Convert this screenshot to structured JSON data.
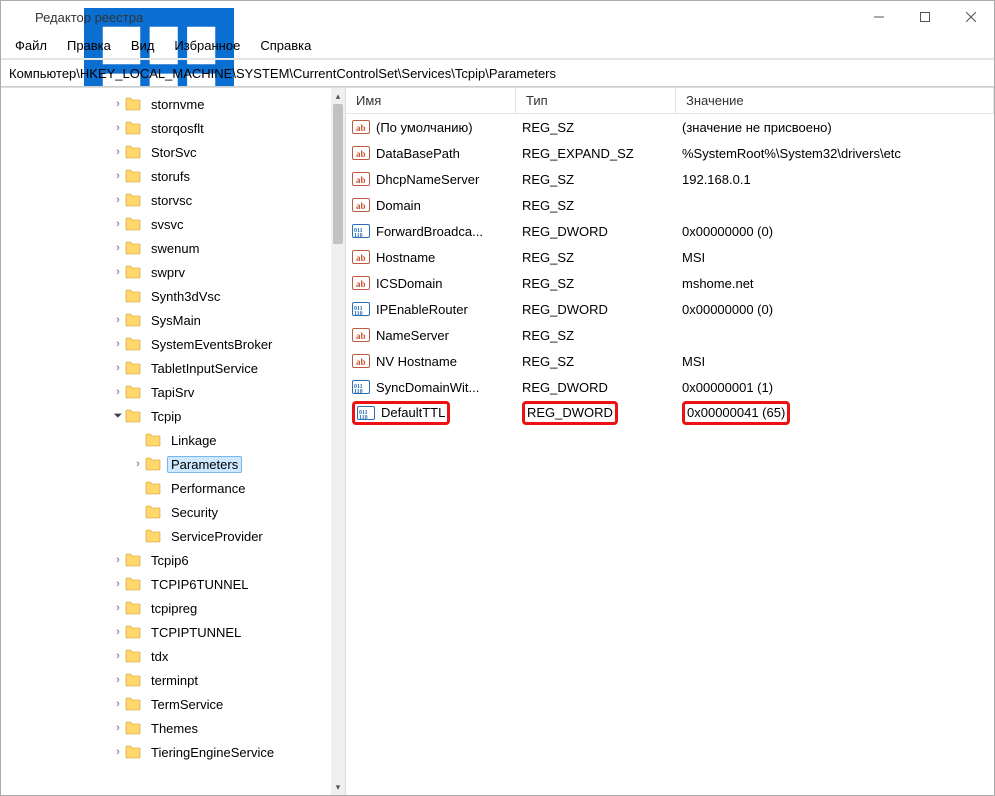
{
  "window": {
    "title": "Редактор реестра"
  },
  "menu": {
    "file": "Файл",
    "edit": "Правка",
    "view": "Вид",
    "fav": "Избранное",
    "help": "Справка"
  },
  "address": "Компьютер\\HKEY_LOCAL_MACHINE\\SYSTEM\\CurrentControlSet\\Services\\Tcpip\\Parameters",
  "tree": {
    "items": [
      {
        "label": "stornvme",
        "depth": 4,
        "chev": "closed"
      },
      {
        "label": "storqosflt",
        "depth": 4,
        "chev": "closed"
      },
      {
        "label": "StorSvc",
        "depth": 4,
        "chev": "closed"
      },
      {
        "label": "storufs",
        "depth": 4,
        "chev": "closed"
      },
      {
        "label": "storvsc",
        "depth": 4,
        "chev": "closed"
      },
      {
        "label": "svsvc",
        "depth": 4,
        "chev": "closed"
      },
      {
        "label": "swenum",
        "depth": 4,
        "chev": "closed"
      },
      {
        "label": "swprv",
        "depth": 4,
        "chev": "closed"
      },
      {
        "label": "Synth3dVsc",
        "depth": 4,
        "chev": "none"
      },
      {
        "label": "SysMain",
        "depth": 4,
        "chev": "closed"
      },
      {
        "label": "SystemEventsBroker",
        "depth": 4,
        "chev": "closed"
      },
      {
        "label": "TabletInputService",
        "depth": 4,
        "chev": "closed"
      },
      {
        "label": "TapiSrv",
        "depth": 4,
        "chev": "closed"
      },
      {
        "label": "Tcpip",
        "depth": 4,
        "chev": "open"
      },
      {
        "label": "Linkage",
        "depth": 5,
        "chev": "none"
      },
      {
        "label": "Parameters",
        "depth": 5,
        "chev": "closed",
        "selected": true
      },
      {
        "label": "Performance",
        "depth": 5,
        "chev": "none"
      },
      {
        "label": "Security",
        "depth": 5,
        "chev": "none"
      },
      {
        "label": "ServiceProvider",
        "depth": 5,
        "chev": "none"
      },
      {
        "label": "Tcpip6",
        "depth": 4,
        "chev": "closed"
      },
      {
        "label": "TCPIP6TUNNEL",
        "depth": 4,
        "chev": "closed"
      },
      {
        "label": "tcpipreg",
        "depth": 4,
        "chev": "closed"
      },
      {
        "label": "TCPIPTUNNEL",
        "depth": 4,
        "chev": "closed"
      },
      {
        "label": "tdx",
        "depth": 4,
        "chev": "closed"
      },
      {
        "label": "terminpt",
        "depth": 4,
        "chev": "closed"
      },
      {
        "label": "TermService",
        "depth": 4,
        "chev": "closed"
      },
      {
        "label": "Themes",
        "depth": 4,
        "chev": "closed"
      },
      {
        "label": "TieringEngineService",
        "depth": 4,
        "chev": "closed"
      }
    ]
  },
  "columns": {
    "name": "Имя",
    "type": "Тип",
    "value": "Значение"
  },
  "values": [
    {
      "icon": "sz",
      "name": "(По умолчанию)",
      "type": "REG_SZ",
      "value": "(значение не присвоено)"
    },
    {
      "icon": "sz",
      "name": "DataBasePath",
      "type": "REG_EXPAND_SZ",
      "value": "%SystemRoot%\\System32\\drivers\\etc"
    },
    {
      "icon": "sz",
      "name": "DhcpNameServer",
      "type": "REG_SZ",
      "value": "192.168.0.1"
    },
    {
      "icon": "sz",
      "name": "Domain",
      "type": "REG_SZ",
      "value": ""
    },
    {
      "icon": "bin",
      "name": "ForwardBroadca...",
      "type": "REG_DWORD",
      "value": "0x00000000 (0)"
    },
    {
      "icon": "sz",
      "name": "Hostname",
      "type": "REG_SZ",
      "value": "MSI"
    },
    {
      "icon": "sz",
      "name": "ICSDomain",
      "type": "REG_SZ",
      "value": "mshome.net"
    },
    {
      "icon": "bin",
      "name": "IPEnableRouter",
      "type": "REG_DWORD",
      "value": "0x00000000 (0)"
    },
    {
      "icon": "sz",
      "name": "NameServer",
      "type": "REG_SZ",
      "value": ""
    },
    {
      "icon": "sz",
      "name": "NV Hostname",
      "type": "REG_SZ",
      "value": "MSI"
    },
    {
      "icon": "bin",
      "name": "SyncDomainWit...",
      "type": "REG_DWORD",
      "value": "0x00000001 (1)"
    },
    {
      "icon": "bin",
      "name": "DefaultTTL",
      "type": "REG_DWORD",
      "value": "0x00000041 (65)",
      "highlight": true
    }
  ]
}
